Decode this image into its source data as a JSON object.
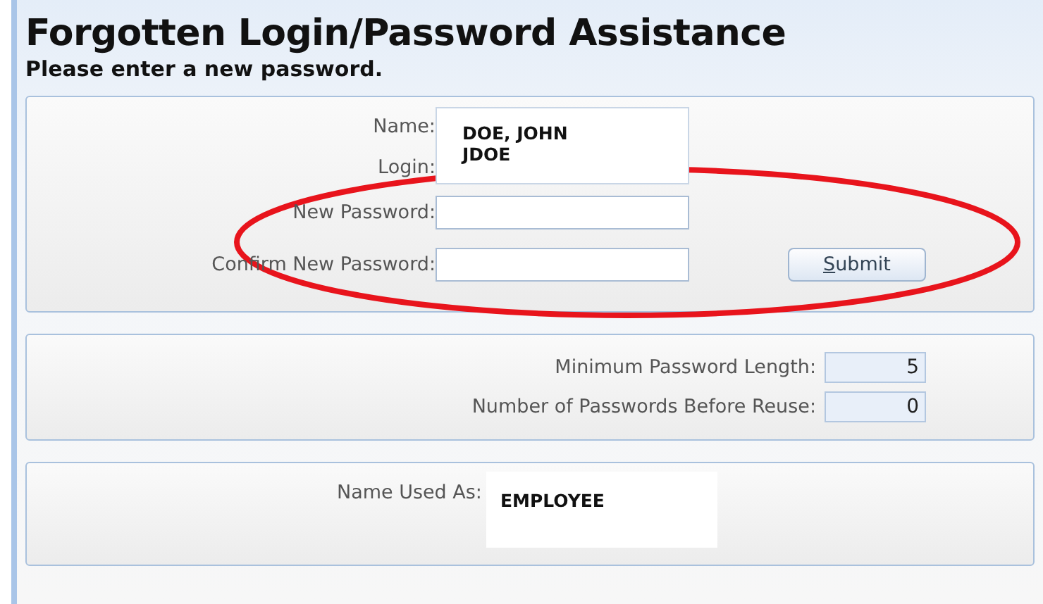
{
  "title": "Forgotten Login/Password Assistance",
  "subtitle": "Please enter a new password.",
  "account": {
    "name_label": "Name:",
    "login_label": "Login:",
    "name": "DOE, JOHN",
    "login": "JDOE"
  },
  "password_fields": [
    {
      "label": "New Password:"
    },
    {
      "label": "Confirm New Password:"
    }
  ],
  "submit_button": {
    "label": "Submit"
  },
  "policy": [
    {
      "label": "Minimum Password Length:",
      "value": "5"
    },
    {
      "label": "Number of Passwords Before Reuse:",
      "value": "0"
    }
  ],
  "name_used_as": {
    "label": "Name Used As:",
    "value": "EMPLOYEE"
  },
  "annotations": [
    {
      "kind": "ellipse"
    }
  ]
}
